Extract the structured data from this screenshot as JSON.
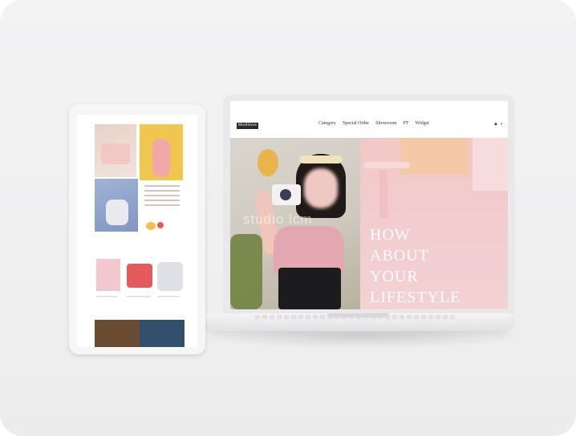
{
  "laptop_site": {
    "logo": "ModiStore",
    "menu": [
      "Category",
      "Special Order",
      "Showroom",
      "PT",
      "Widget"
    ],
    "hero_title_lines": [
      "HOW",
      "ABOUT",
      "YOUR",
      "LIFESTYLE"
    ],
    "watermark": "studio lcm"
  },
  "colors": {
    "card_bg": "#f0f0f1",
    "hero_pink": "#f2cdd0"
  },
  "icons": [
    "lock-icon",
    "search-icon"
  ]
}
